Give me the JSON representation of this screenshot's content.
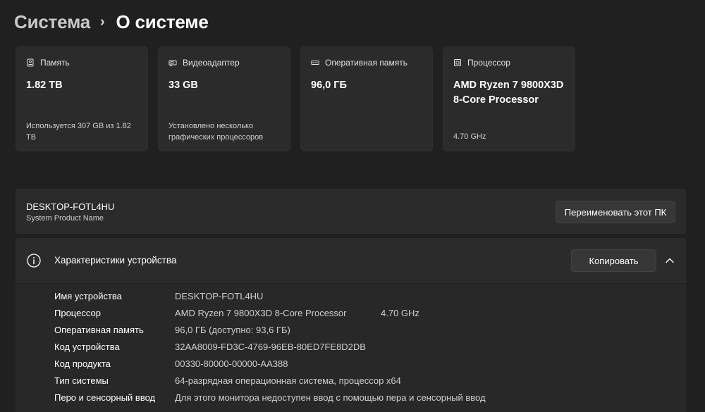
{
  "breadcrumb": {
    "parent": "Система",
    "separator": "›",
    "current": "О системе"
  },
  "cards": [
    {
      "icon": "storage-icon",
      "label": "Память",
      "value": "1.82 TB",
      "note": "Используется 307 GB из 1.82 TB"
    },
    {
      "icon": "display-adapter-icon",
      "label": "Видеоадаптер",
      "value": "33 GB",
      "note": "Установлено несколько графических процессоров"
    },
    {
      "icon": "ram-icon",
      "label": "Оперативная память",
      "value": "96,0 ГБ",
      "note": ""
    },
    {
      "icon": "processor-icon",
      "label": "Процессор",
      "value": "AMD Ryzen 7 9800X3D 8-Core Processor",
      "note": "4.70 GHz"
    }
  ],
  "device": {
    "name": "DESKTOP-FOTL4HU",
    "subtitle": "System Product Name",
    "rename_label": "Переименовать этот ПК"
  },
  "specs": {
    "icon": "info-icon",
    "title": "Характеристики устройства",
    "copy_label": "Копировать",
    "expanded": true,
    "rows": [
      {
        "label": "Имя устройства",
        "value": "DESKTOP-FOTL4HU",
        "extra": ""
      },
      {
        "label": "Процессор",
        "value": "AMD Ryzen 7 9800X3D 8-Core Processor",
        "extra": "4.70 GHz"
      },
      {
        "label": "Оперативная память",
        "value": "96,0 ГБ (доступно: 93,6 ГБ)",
        "extra": ""
      },
      {
        "label": "Код устройства",
        "value": "32AA8009-FD3C-4769-96EB-80ED7FE8D2DB",
        "extra": ""
      },
      {
        "label": "Код продукта",
        "value": "00330-80000-00000-AA388",
        "extra": ""
      },
      {
        "label": "Тип системы",
        "value": "64-разрядная операционная система, процессор x64",
        "extra": ""
      },
      {
        "label": "Перо и сенсорный ввод",
        "value": "Для этого монитора недоступен ввод с помощью пера и сенсорный ввод",
        "extra": ""
      }
    ]
  },
  "colors": {
    "background": "#202020",
    "card": "#2b2b2b",
    "button": "#373737"
  }
}
